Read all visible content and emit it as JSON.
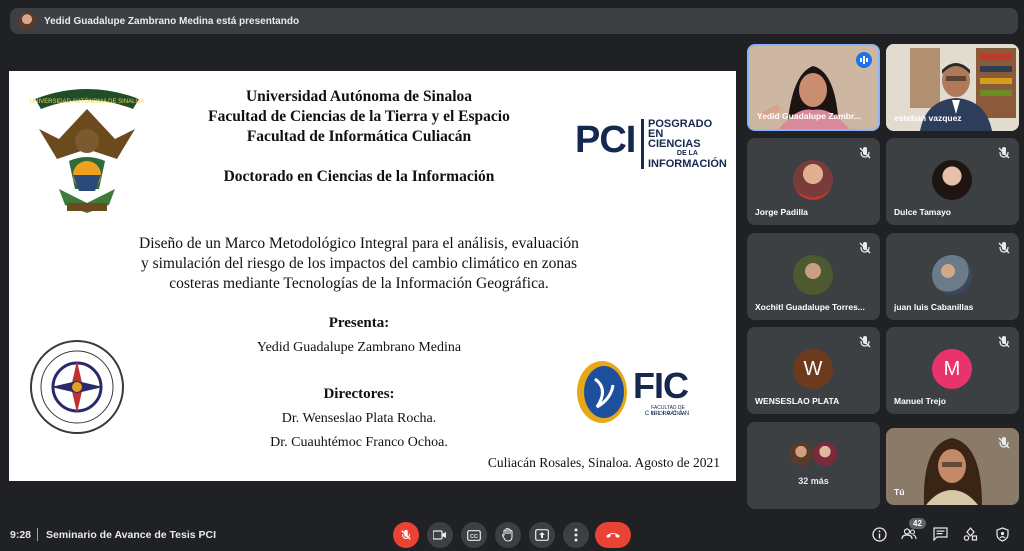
{
  "topbar": {
    "presenting_text": "Yedid Guadalupe Zambrano Medina está presentando"
  },
  "slide": {
    "university_lines": [
      "Universidad Autónoma de Sinaloa",
      "Facultad de Ciencias de la Tierra y el Espacio",
      "Facultad de Informática Culiacán"
    ],
    "program": "Doctorado en Ciencias de la Información",
    "thesis_lines": [
      "Diseño de un Marco Metodológico Integral para el análisis, evaluación",
      "y simulación del riesgo de los impactos del cambio climático en zonas",
      "costeras mediante Tecnologías de la Información Geográfica."
    ],
    "presenta_label": "Presenta:",
    "presenter": "Yedid Guadalupe Zambrano Medina",
    "directores_label": "Directores:",
    "director1": "Dr. Wenseslao Plata Rocha.",
    "director2": "Dr. Cuauhtémoc Franco Ochoa.",
    "place_date": "Culiacán Rosales, Sinaloa. Agosto de 2021",
    "pci_logo": {
      "big": "PCI",
      "line1": "POSGRADO EN",
      "line2": "CIENCIAS",
      "line3": "DE LA",
      "line4": "INFORMACIÓN"
    },
    "fic_logo": {
      "big": "FIC",
      "sub": "FACULTAD DE INFORMÁTICA",
      "sub2": "CULIACÁN"
    },
    "uas_logo_text": "UNIVERSIDAD AUTÓNOMA DE SINALOA"
  },
  "participants": [
    {
      "name": "Yedid Guadalupe Zambr...",
      "type": "video",
      "speaking": true
    },
    {
      "name": "esteban vazquez",
      "type": "video"
    },
    {
      "name": "Jorge Padilla",
      "type": "avatar",
      "color": "#7a3b3b"
    },
    {
      "name": "Dulce Tamayo",
      "type": "avatar",
      "color": "#2b1f1a"
    },
    {
      "name": "Xochitl Guadalupe Torres...",
      "type": "avatar",
      "color": "#4d5a2f"
    },
    {
      "name": "juan luis Cabanillas",
      "type": "avatar",
      "color": "#6b7b8c"
    },
    {
      "name": "WENSESLAO PLATA",
      "type": "letter",
      "letter": "W",
      "color": "#6d3a1e"
    },
    {
      "name": "Manuel Trejo",
      "type": "letter",
      "letter": "M",
      "color": "#e8336d"
    },
    {
      "name": "32 más",
      "type": "more"
    },
    {
      "name": "Tú",
      "type": "video"
    }
  ],
  "bottombar": {
    "time": "9:28",
    "meeting_title": "Seminario de Avance de Tesis PCI",
    "participant_count": "42"
  },
  "colors": {
    "background": "#202124",
    "tile": "#3c4043",
    "danger": "#ea4335",
    "accent_blue": "#8ab4f8"
  }
}
